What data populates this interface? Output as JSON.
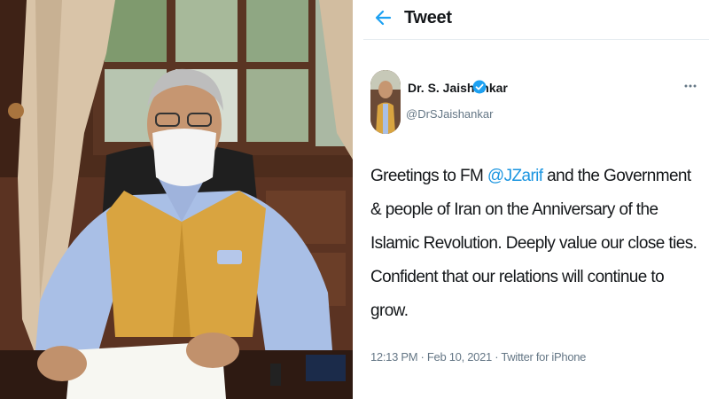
{
  "header": {
    "title": "Tweet",
    "back_icon": "arrow-left-icon"
  },
  "author": {
    "display_name": "Dr. S. Jaishankar",
    "handle": "@DrSJaishankar",
    "verified_icon": "verified-badge-icon",
    "more_icon": "more-options-icon"
  },
  "tweet": {
    "text_before": "Greetings to FM ",
    "mention": "@JZarif",
    "text_after": " and the Government & people of Iran on the Anniversary of the Islamic Revolution. Deeply value our close ties. Confident that our relations will continue to grow.",
    "time": "12:13 PM",
    "separator": " · ",
    "date": "Feb 10, 2021",
    "source": "Twitter for iPhone"
  },
  "colors": {
    "accent": "#1da1f2",
    "mention": "#1b95e0",
    "secondary_text": "#657786"
  }
}
